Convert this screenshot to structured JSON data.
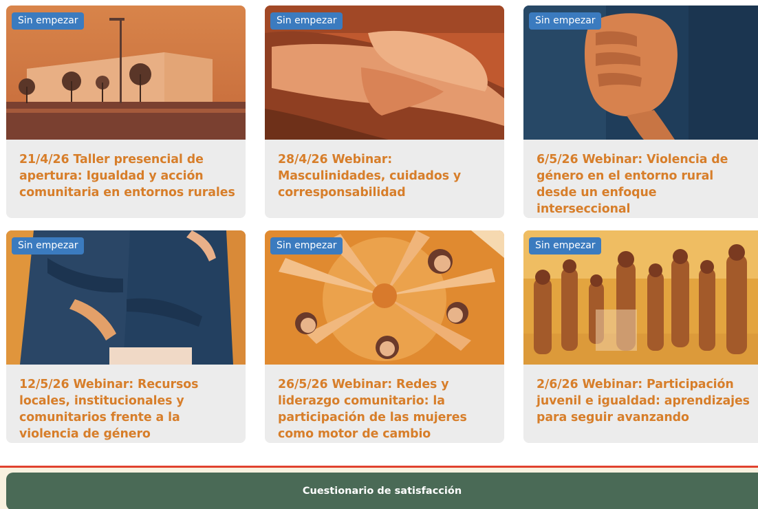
{
  "cards": [
    {
      "badge": "Sin empezar",
      "title": "21/4/26 Taller presencial de apertura: Igualdad y acción comunitaria en entornos rurales",
      "image": "rural-building-street"
    },
    {
      "badge": "Sin empezar",
      "title": "28/4/26 Webinar: Masculinidades, cuidados y corresponsabilidad",
      "image": "holding-hands"
    },
    {
      "badge": "Sin empezar",
      "title": "6/5/26 Webinar: Violencia de género en el entorno rural desde un enfoque interseccional",
      "image": "clenched-fist"
    },
    {
      "badge": "Sin empezar",
      "title": "12/5/26 Webinar: Recursos locales, institucionales y comunitarios frente a la violencia de género",
      "image": "hugging-couple"
    },
    {
      "badge": "Sin empezar",
      "title": "26/5/26 Webinar: Redes y liderazgo comunitario: la participación de las mujeres como motor de cambio",
      "image": "women-hands-together"
    },
    {
      "badge": "Sin empezar",
      "title": "2/6/26 Webinar: Participación juvenil e igualdad: aprendizajes para seguir avanzando",
      "image": "youth-group-circle"
    }
  ],
  "footer": {
    "survey_label": "Cuestionario de satisfacción"
  },
  "colors": {
    "title": "#d77e2a",
    "badge": "#3b7bbf",
    "card_bg": "#ececec",
    "survey_button": "#4a6a56",
    "divider": "#e0412e",
    "footer_strip": "#f8f1df"
  }
}
